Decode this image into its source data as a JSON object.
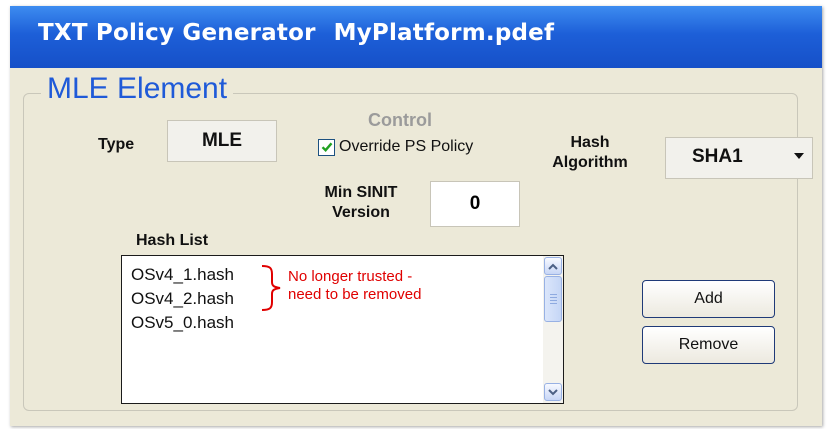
{
  "window": {
    "title": "TXT Policy Generator",
    "filename": "MyPlatform.pdef"
  },
  "group": {
    "legend": "MLE Element"
  },
  "type": {
    "label": "Type",
    "value": "MLE"
  },
  "control": {
    "title": "Control",
    "override_label": "Override PS Policy",
    "override_checked": true
  },
  "hash_algorithm": {
    "label_line1": "Hash",
    "label_line2": "Algorithm",
    "selected": "SHA1"
  },
  "min_sinit": {
    "label_line1": "Min SINIT",
    "label_line2": "Version",
    "value": "0"
  },
  "hash_list": {
    "label": "Hash List",
    "items": [
      "OSv4_1.hash",
      "OSv4_2.hash",
      "OSv5_0.hash"
    ],
    "annotation_line1": "No longer trusted -",
    "annotation_line2": "need to be removed",
    "annotation_color": "#e00000"
  },
  "buttons": {
    "add": "Add",
    "remove": "Remove"
  },
  "colors": {
    "title_bar": "#1d5fd8",
    "legend": "#1f5ad8",
    "window_bg": "#ece9d8"
  }
}
